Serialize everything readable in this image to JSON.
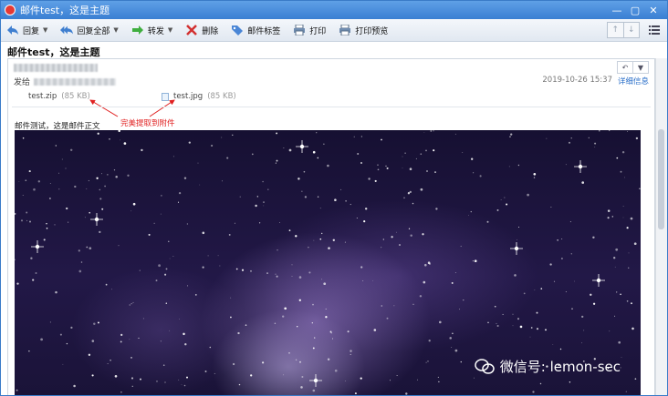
{
  "window": {
    "title": "邮件test，这是主题"
  },
  "toolbar": {
    "reply": "回复",
    "reply_all": "回复全部",
    "forward": "转发",
    "delete": "删除",
    "tag": "邮件标签",
    "print": "打印",
    "print_preview": "打印预览"
  },
  "mail": {
    "subject": "邮件test，这是主题",
    "to_label": "发给",
    "date": "2019-10-26 15:37",
    "details": "详细信息",
    "attachments": [
      {
        "name": "test.zip",
        "size": "(85 KB)"
      },
      {
        "name": "test.jpg",
        "size": "(85 KB)"
      }
    ],
    "annotation": "完美提取到附件",
    "body": "邮件测试，这是邮件正文"
  },
  "watermark": {
    "text": "微信号: lemon-sec"
  },
  "colors": {
    "annotation": "#e02020",
    "link": "#2a6fc9",
    "titlebar": "#3a7fd3"
  }
}
